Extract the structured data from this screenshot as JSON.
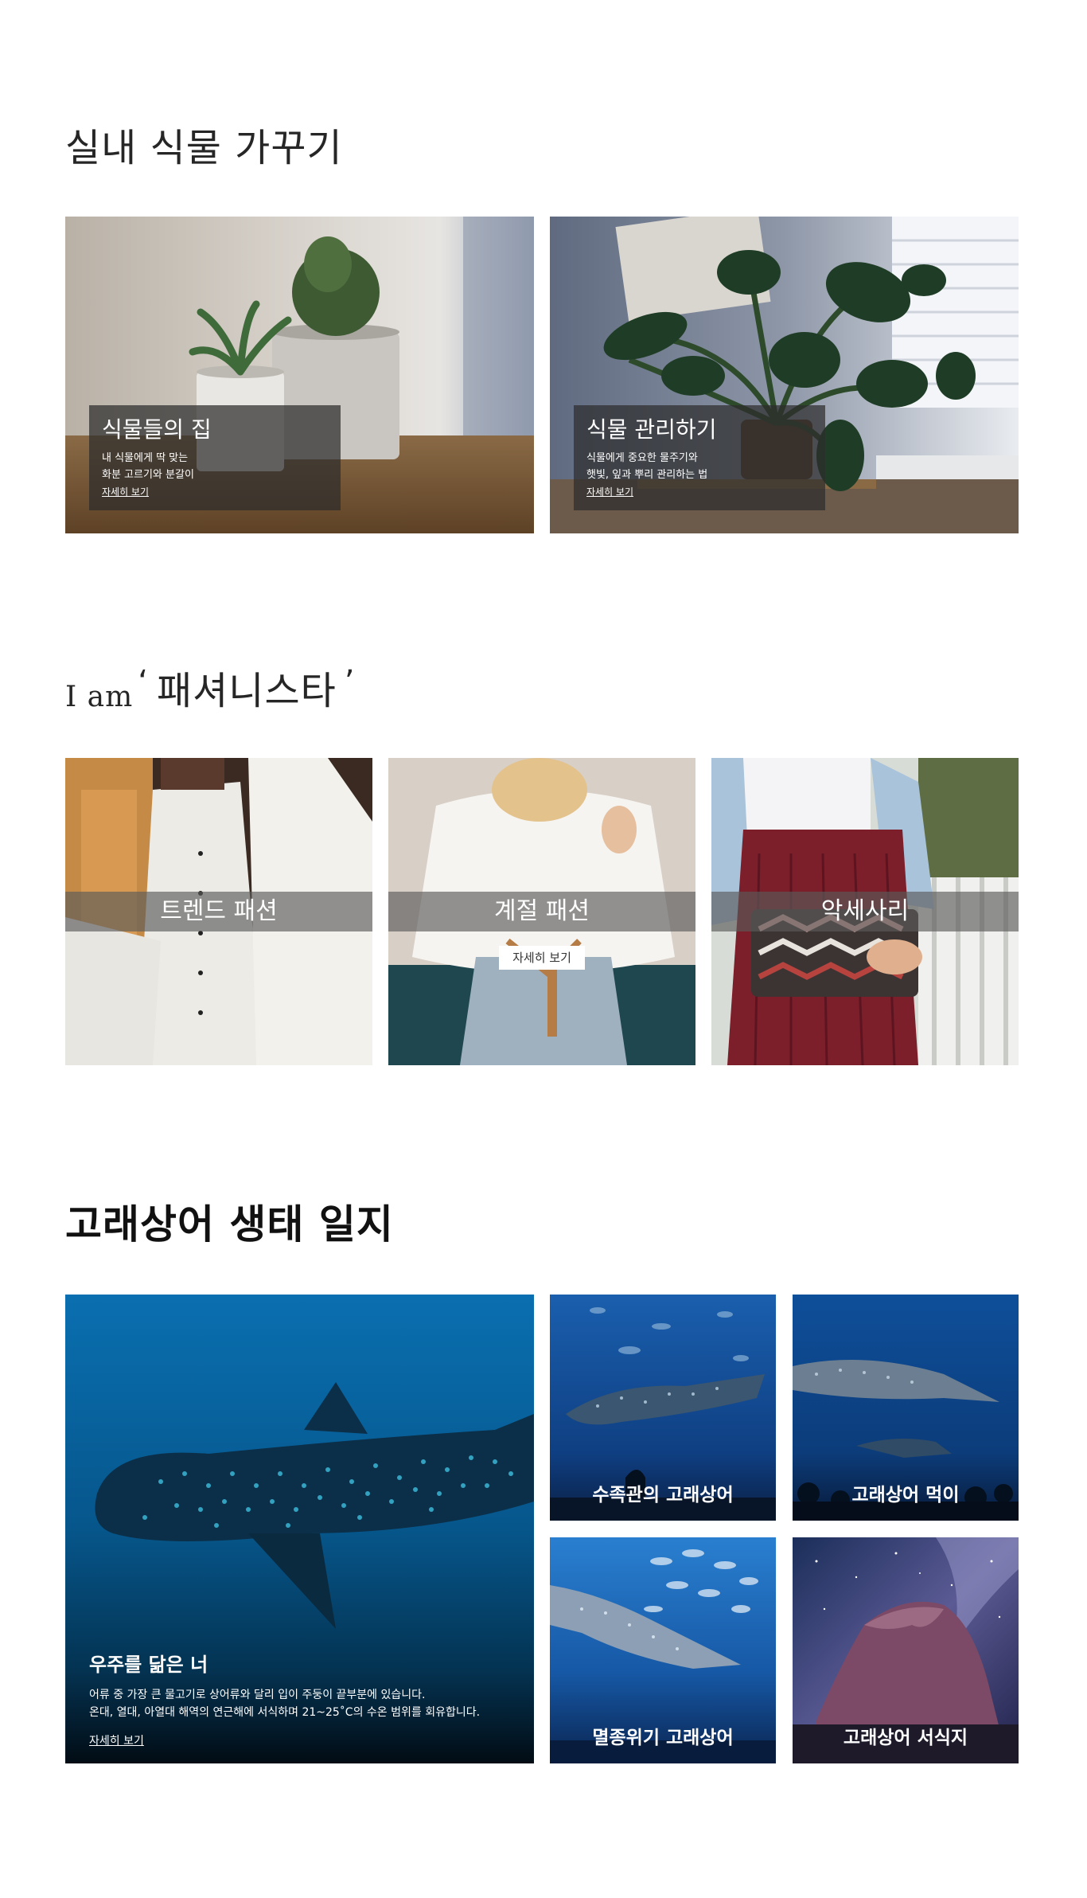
{
  "plants": {
    "title": "실내 식물 가꾸기",
    "cards": [
      {
        "title": "식물들의 집",
        "desc": "내 식물에게 딱 맞는\n화분 고르기와 분갈이",
        "more": "자세히 보기"
      },
      {
        "title": "식물 관리하기",
        "desc": "식물에게 중요한 물주기와\n햇빛, 잎과 뿌리 관리하는 법",
        "more": "자세히 보기"
      }
    ]
  },
  "fashion": {
    "title_latin": "I am",
    "title_open_quote": "‘",
    "title_main": "패셔니스타",
    "title_close_quote": "’",
    "cards": [
      {
        "title": "트렌드 패션"
      },
      {
        "title": "계절 패션",
        "more": "자세히 보기"
      },
      {
        "title": "악세사리"
      }
    ]
  },
  "sharks": {
    "title": "고래상어 생태 일지",
    "main": {
      "title": "우주를 닮은 너",
      "desc": "어류 중 가장 큰 물고기로 상어류와 달리 입이 주둥이 끝부분에 있습니다.\n온대, 열대, 아열대 해역의 연근해에 서식하며 21~25˚C의 수온 범위를 회유합니다.",
      "more": "자세히 보기"
    },
    "cards": [
      {
        "title": "수족관의 고래상어"
      },
      {
        "title": "고래상어 먹이"
      },
      {
        "title": "멸종위기 고래상어"
      },
      {
        "title": "고래상어 서식지"
      }
    ]
  }
}
